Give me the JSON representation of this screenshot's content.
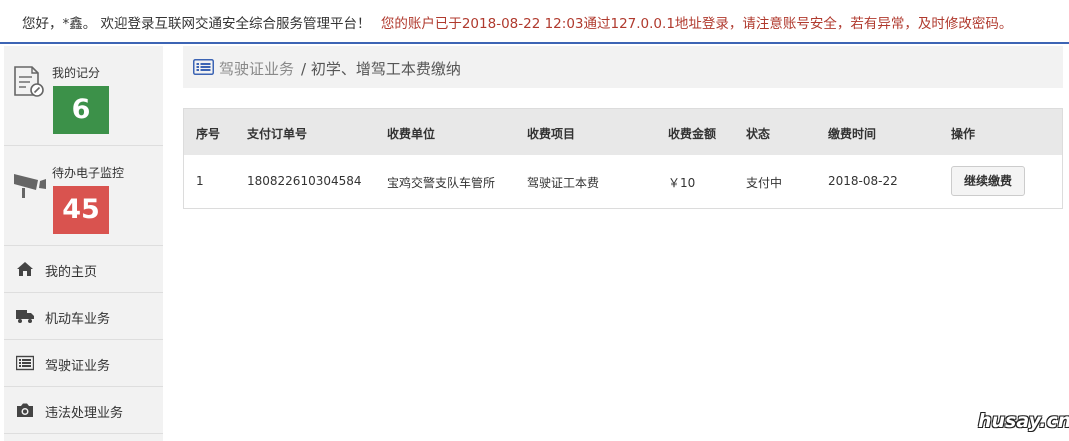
{
  "topbar": {
    "greeting": "您好，*鑫。 欢迎登录互联网交通安全综合服务管理平台！",
    "login_notice": "您的账户已于2018-08-22 12:03通过127.0.0.1地址登录，请注意账号安全，若有异常，及时修改密码。"
  },
  "sidebar": {
    "points_card": {
      "label": "我的记分",
      "value": "6",
      "icon": "document-pen-icon",
      "color": "#3c9149"
    },
    "monitor_card": {
      "label": "待办电子监控",
      "value": "45",
      "icon": "camera-icon",
      "color": "#d9534f"
    },
    "nav": [
      {
        "label": "我的主页",
        "icon": "home-icon"
      },
      {
        "label": "机动车业务",
        "icon": "truck-icon"
      },
      {
        "label": "驾驶证业务",
        "icon": "list-card-icon"
      },
      {
        "label": "违法处理业务",
        "icon": "photo-camera-icon"
      }
    ]
  },
  "breadcrumb": {
    "section": "驾驶证业务",
    "page": "/ 初学、增驾工本费缴纳"
  },
  "table": {
    "headers": [
      "序号",
      "支付订单号",
      "收费单位",
      "收费项目",
      "收费金额",
      "状态",
      "缴费时间",
      "操作"
    ],
    "rows": [
      {
        "index": "1",
        "order_no": "180822610304584",
        "unit": "宝鸡交警支队车管所",
        "item": "驾驶证工本费",
        "amount": "￥10",
        "status": "支付中",
        "time": "2018-08-22",
        "action": "继续缴费"
      }
    ]
  },
  "watermark": "husay.cn",
  "colors": {
    "accent": "#3c64b4",
    "warning_text": "#b03a2e"
  }
}
